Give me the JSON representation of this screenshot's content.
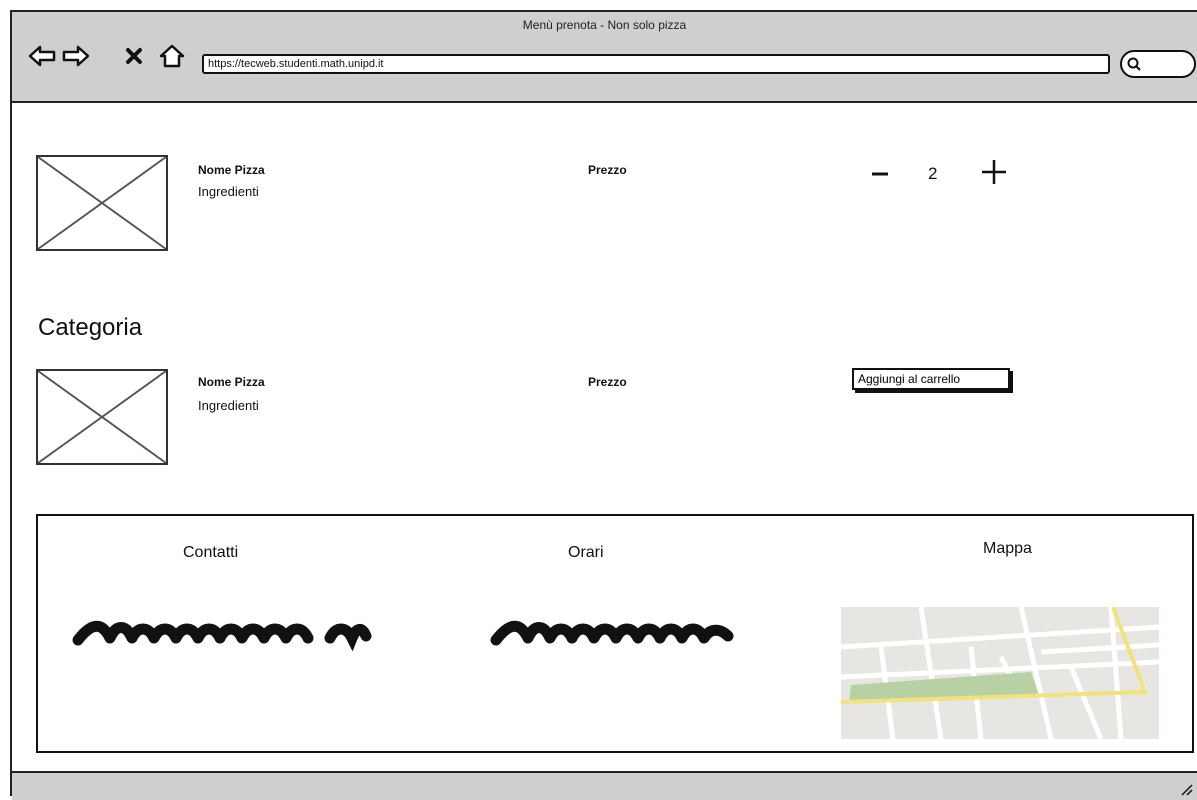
{
  "window": {
    "title": "Menù prenota - Non solo pizza",
    "url": "https://tecweb.studenti.math.unipd.it"
  },
  "nav_icons": [
    "back-arrow-icon",
    "forward-arrow-icon",
    "close-icon",
    "home-icon",
    "search-icon"
  ],
  "menu": {
    "items": [
      {
        "name": "Nome Pizza",
        "ingredients": "Ingredienti",
        "price": "Prezzo",
        "quantity": "2"
      },
      {
        "name": "Nome Pizza",
        "ingredients": "Ingredienti",
        "price": "Prezzo",
        "add_label": "Aggiungi al carrello"
      }
    ],
    "category_title": "Categoria"
  },
  "footer": {
    "contacts_heading": "Contatti",
    "hours_heading": "Orari",
    "map_heading": "Mappa"
  }
}
